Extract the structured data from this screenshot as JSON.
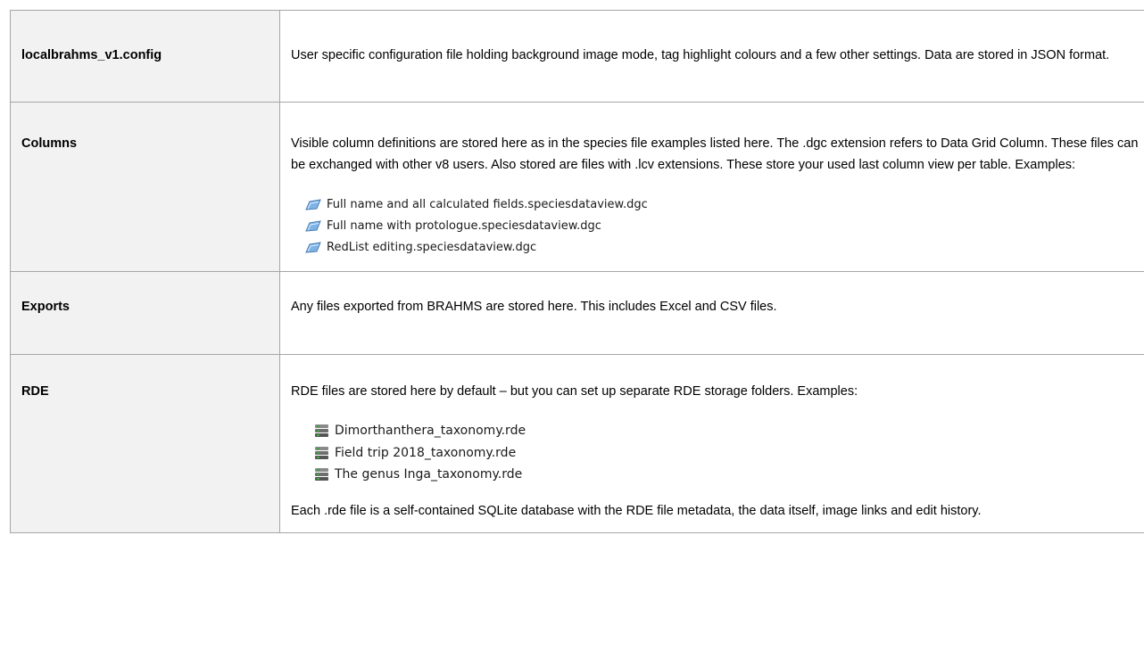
{
  "rows": [
    {
      "key": "localbrahms_v1.config",
      "desc": "User specific configuration file holding background image mode, tag highlight colours and a few other settings. Data are stored in JSON format."
    },
    {
      "key": "Columns",
      "desc": "Visible column definitions are stored here as in the species file examples listed here. The .dgc extension refers to Data Grid Column. These files can be exchanged with other v8 users. Also stored are files with .lcv extensions. These store your used last column view per table. Examples:",
      "files": [
        {
          "name": "Full name and all calculated fields.speciesdataview.dgc",
          "icon": "dgc-file-icon"
        },
        {
          "name": "Full name with protologue.speciesdataview.dgc",
          "icon": "dgc-file-icon"
        },
        {
          "name": "RedList editing.speciesdataview.dgc",
          "icon": "dgc-file-icon"
        }
      ]
    },
    {
      "key": "Exports",
      "desc": "Any files exported from BRAHMS are stored here. This includes Excel and CSV files."
    },
    {
      "key": "RDE",
      "desc": "RDE files are stored here by default – but you can set up separate RDE storage folders. Examples:",
      "files": [
        {
          "name": "Dimorthanthera_taxonomy.rde",
          "icon": "database-icon"
        },
        {
          "name": "Field trip 2018_taxonomy.rde",
          "icon": "database-icon"
        },
        {
          "name": "The genus Inga_taxonomy.rde",
          "icon": "database-icon"
        }
      ],
      "note": "Each .rde file is a self-contained SQLite database with the RDE file metadata, the data itself, image links and edit history."
    }
  ],
  "colors": {
    "key_background": "#f2f2f2",
    "border": "#a6a6a6"
  }
}
